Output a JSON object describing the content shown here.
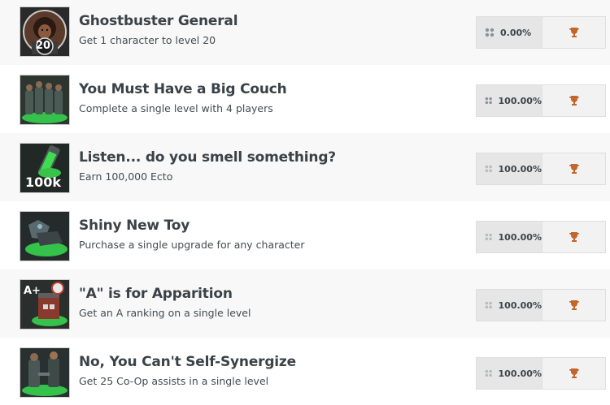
{
  "achievements": [
    {
      "title": "Ghostbuster General",
      "description": "Get 1 character to level 20",
      "percent": "0.00%",
      "badge_text": "20",
      "icon": "character-level-icon",
      "trophy_color": "#c4652b"
    },
    {
      "title": "You Must Have a Big Couch",
      "description": "Complete a single level with 4 players",
      "percent": "100.00%",
      "icon": "team-of-four-icon",
      "trophy_color": "#c4652b"
    },
    {
      "title": "Listen... do you smell something?",
      "description": "Earn 100,000 Ecto",
      "percent": "100.00%",
      "badge_text": "100k",
      "icon": "ecto-vial-icon",
      "trophy_color": "#c4652b"
    },
    {
      "title": "Shiny New Toy",
      "description": "Purchase a single upgrade for any character",
      "percent": "100.00%",
      "icon": "proton-pack-upgrade-icon",
      "trophy_color": "#c4652b"
    },
    {
      "title": "\"A\" is for Apparition",
      "description": "Get an A ranking on a single level",
      "percent": "100.00%",
      "badge_text": "A+",
      "icon": "firehouse-ranking-icon",
      "trophy_color": "#c4652b"
    },
    {
      "title": "No, You Can't Self-Synergize",
      "description": "Get 25 Co-Op assists in a single level",
      "percent": "100.00%",
      "icon": "coop-assist-icon",
      "trophy_color": "#c4652b"
    }
  ]
}
